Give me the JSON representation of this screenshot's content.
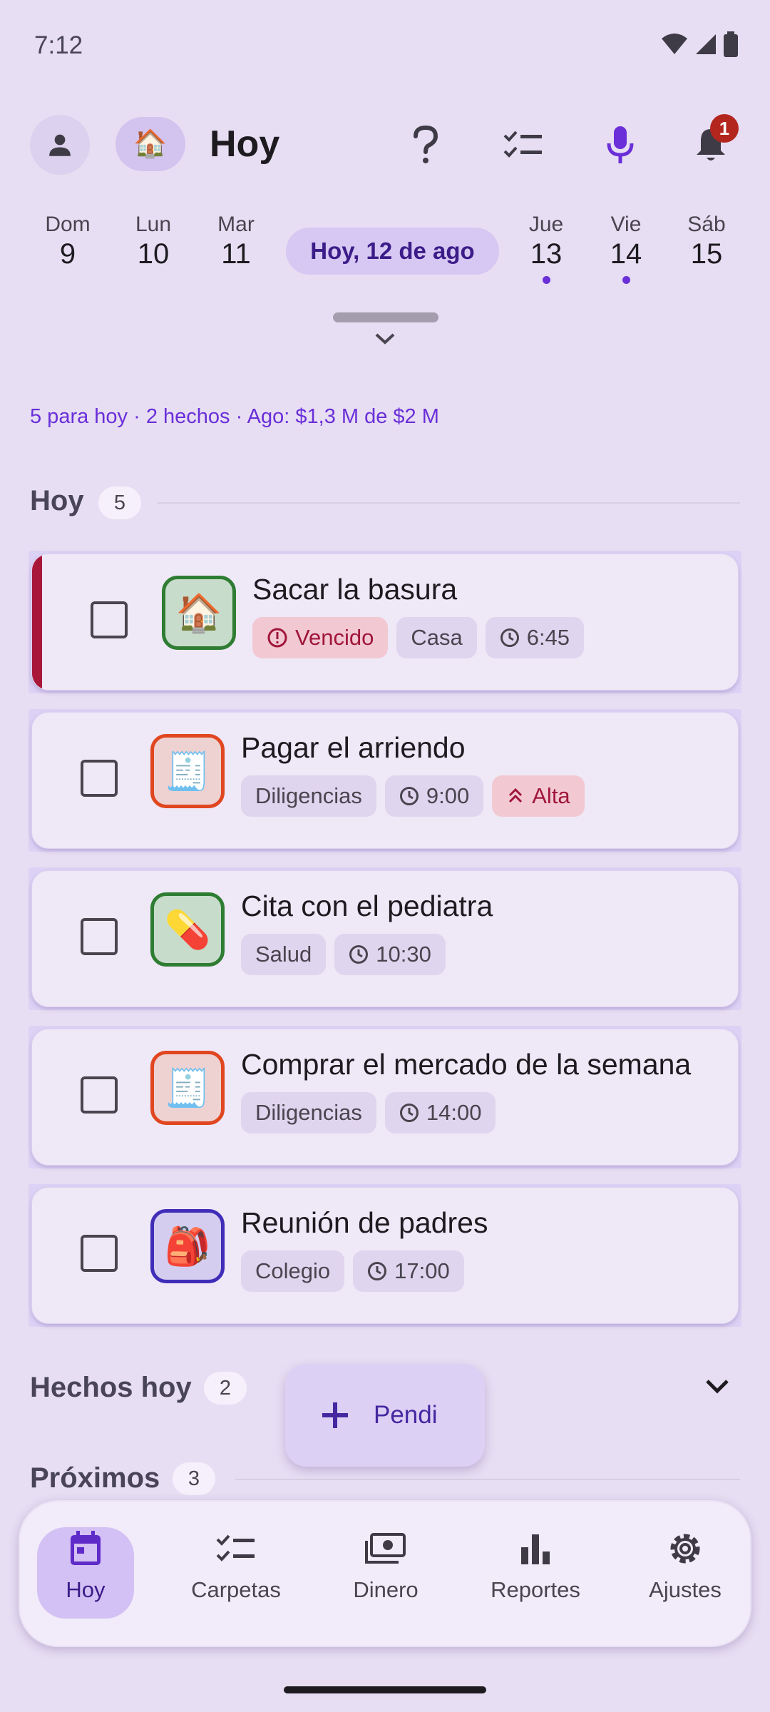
{
  "status_bar": {
    "time": "7:12"
  },
  "header": {
    "title": "Hoy",
    "home_emoji": "🏠",
    "notifications_count": "1",
    "icons": [
      "person-icon",
      "help-icon",
      "checklist-icon",
      "microphone-icon",
      "bell-icon"
    ]
  },
  "date_strip": {
    "days": [
      {
        "dow": "Dom",
        "num": "9",
        "dot": false
      },
      {
        "dow": "Lun",
        "num": "10",
        "dot": false
      },
      {
        "dow": "Mar",
        "num": "11",
        "dot": false
      },
      {
        "dow": "Jue",
        "num": "13",
        "dot": true
      },
      {
        "dow": "Vie",
        "num": "14",
        "dot": true
      },
      {
        "dow": "Sáb",
        "num": "15",
        "dot": false
      }
    ],
    "today_label": "Hoy, 12 de ago"
  },
  "summary": "5 para hoy · 2 hechos · Ago: $1,3 M de $2 M",
  "sections": {
    "today": {
      "title": "Hoy",
      "count": "5"
    },
    "done": {
      "title": "Hechos hoy",
      "count": "2"
    },
    "upcoming": {
      "title": "Próximos",
      "count": "3"
    }
  },
  "tasks": [
    {
      "title": "Sacar la basura",
      "icon": "🏠",
      "icon_name": "house-icon",
      "border": "#2E7D32",
      "bg": "#C8DCCB",
      "chips": [
        {
          "type": "overdue",
          "icon": "alert-icon",
          "text": "Vencido"
        },
        {
          "type": "tag",
          "text": "Casa"
        },
        {
          "type": "time",
          "icon": "clock-icon",
          "text": "6:45"
        }
      ]
    },
    {
      "title": "Pagar el arriendo",
      "icon": "🧾",
      "icon_name": "receipt-icon",
      "border": "#E0461F",
      "bg": "#EED2D2",
      "chips": [
        {
          "type": "tag",
          "text": "Diligencias"
        },
        {
          "type": "time",
          "icon": "clock-icon",
          "text": "9:00"
        },
        {
          "type": "high",
          "icon": "priority-icon",
          "text": "Alta"
        }
      ]
    },
    {
      "title": "Cita con el pediatra",
      "icon": "💊",
      "icon_name": "pill-icon",
      "border": "#2E7D32",
      "bg": "#C8DCCB",
      "chips": [
        {
          "type": "tag",
          "text": "Salud"
        },
        {
          "type": "time",
          "icon": "clock-icon",
          "text": "10:30"
        }
      ]
    },
    {
      "title": "Comprar el mercado de la semana",
      "icon": "🧾",
      "icon_name": "receipt-icon",
      "border": "#E0461F",
      "bg": "#EED2D2",
      "chips": [
        {
          "type": "tag",
          "text": "Diligencias"
        },
        {
          "type": "time",
          "icon": "clock-icon",
          "text": "14:00"
        }
      ]
    },
    {
      "title": "Reunión de padres",
      "icon": "🎒",
      "icon_name": "backpack-icon",
      "border": "#3F2DB8",
      "bg": "#D4CDF0",
      "chips": [
        {
          "type": "tag",
          "text": "Colegio"
        },
        {
          "type": "time",
          "icon": "clock-icon",
          "text": "17:00"
        }
      ]
    }
  ],
  "fab": {
    "label": "Pendi",
    "icon": "plus-icon"
  },
  "bottom_nav": [
    {
      "label": "Hoy",
      "icon": "calendar-icon",
      "active": true
    },
    {
      "label": "Carpetas",
      "icon": "checklist-icon",
      "active": false
    },
    {
      "label": "Dinero",
      "icon": "money-icon",
      "active": false
    },
    {
      "label": "Reportes",
      "icon": "bar-chart-icon",
      "active": false
    },
    {
      "label": "Ajustes",
      "icon": "gear-icon",
      "active": false
    }
  ],
  "colors": {
    "accent": "#6A2FD8",
    "overdue": "#A8163A",
    "background": "#E7DEF3"
  }
}
